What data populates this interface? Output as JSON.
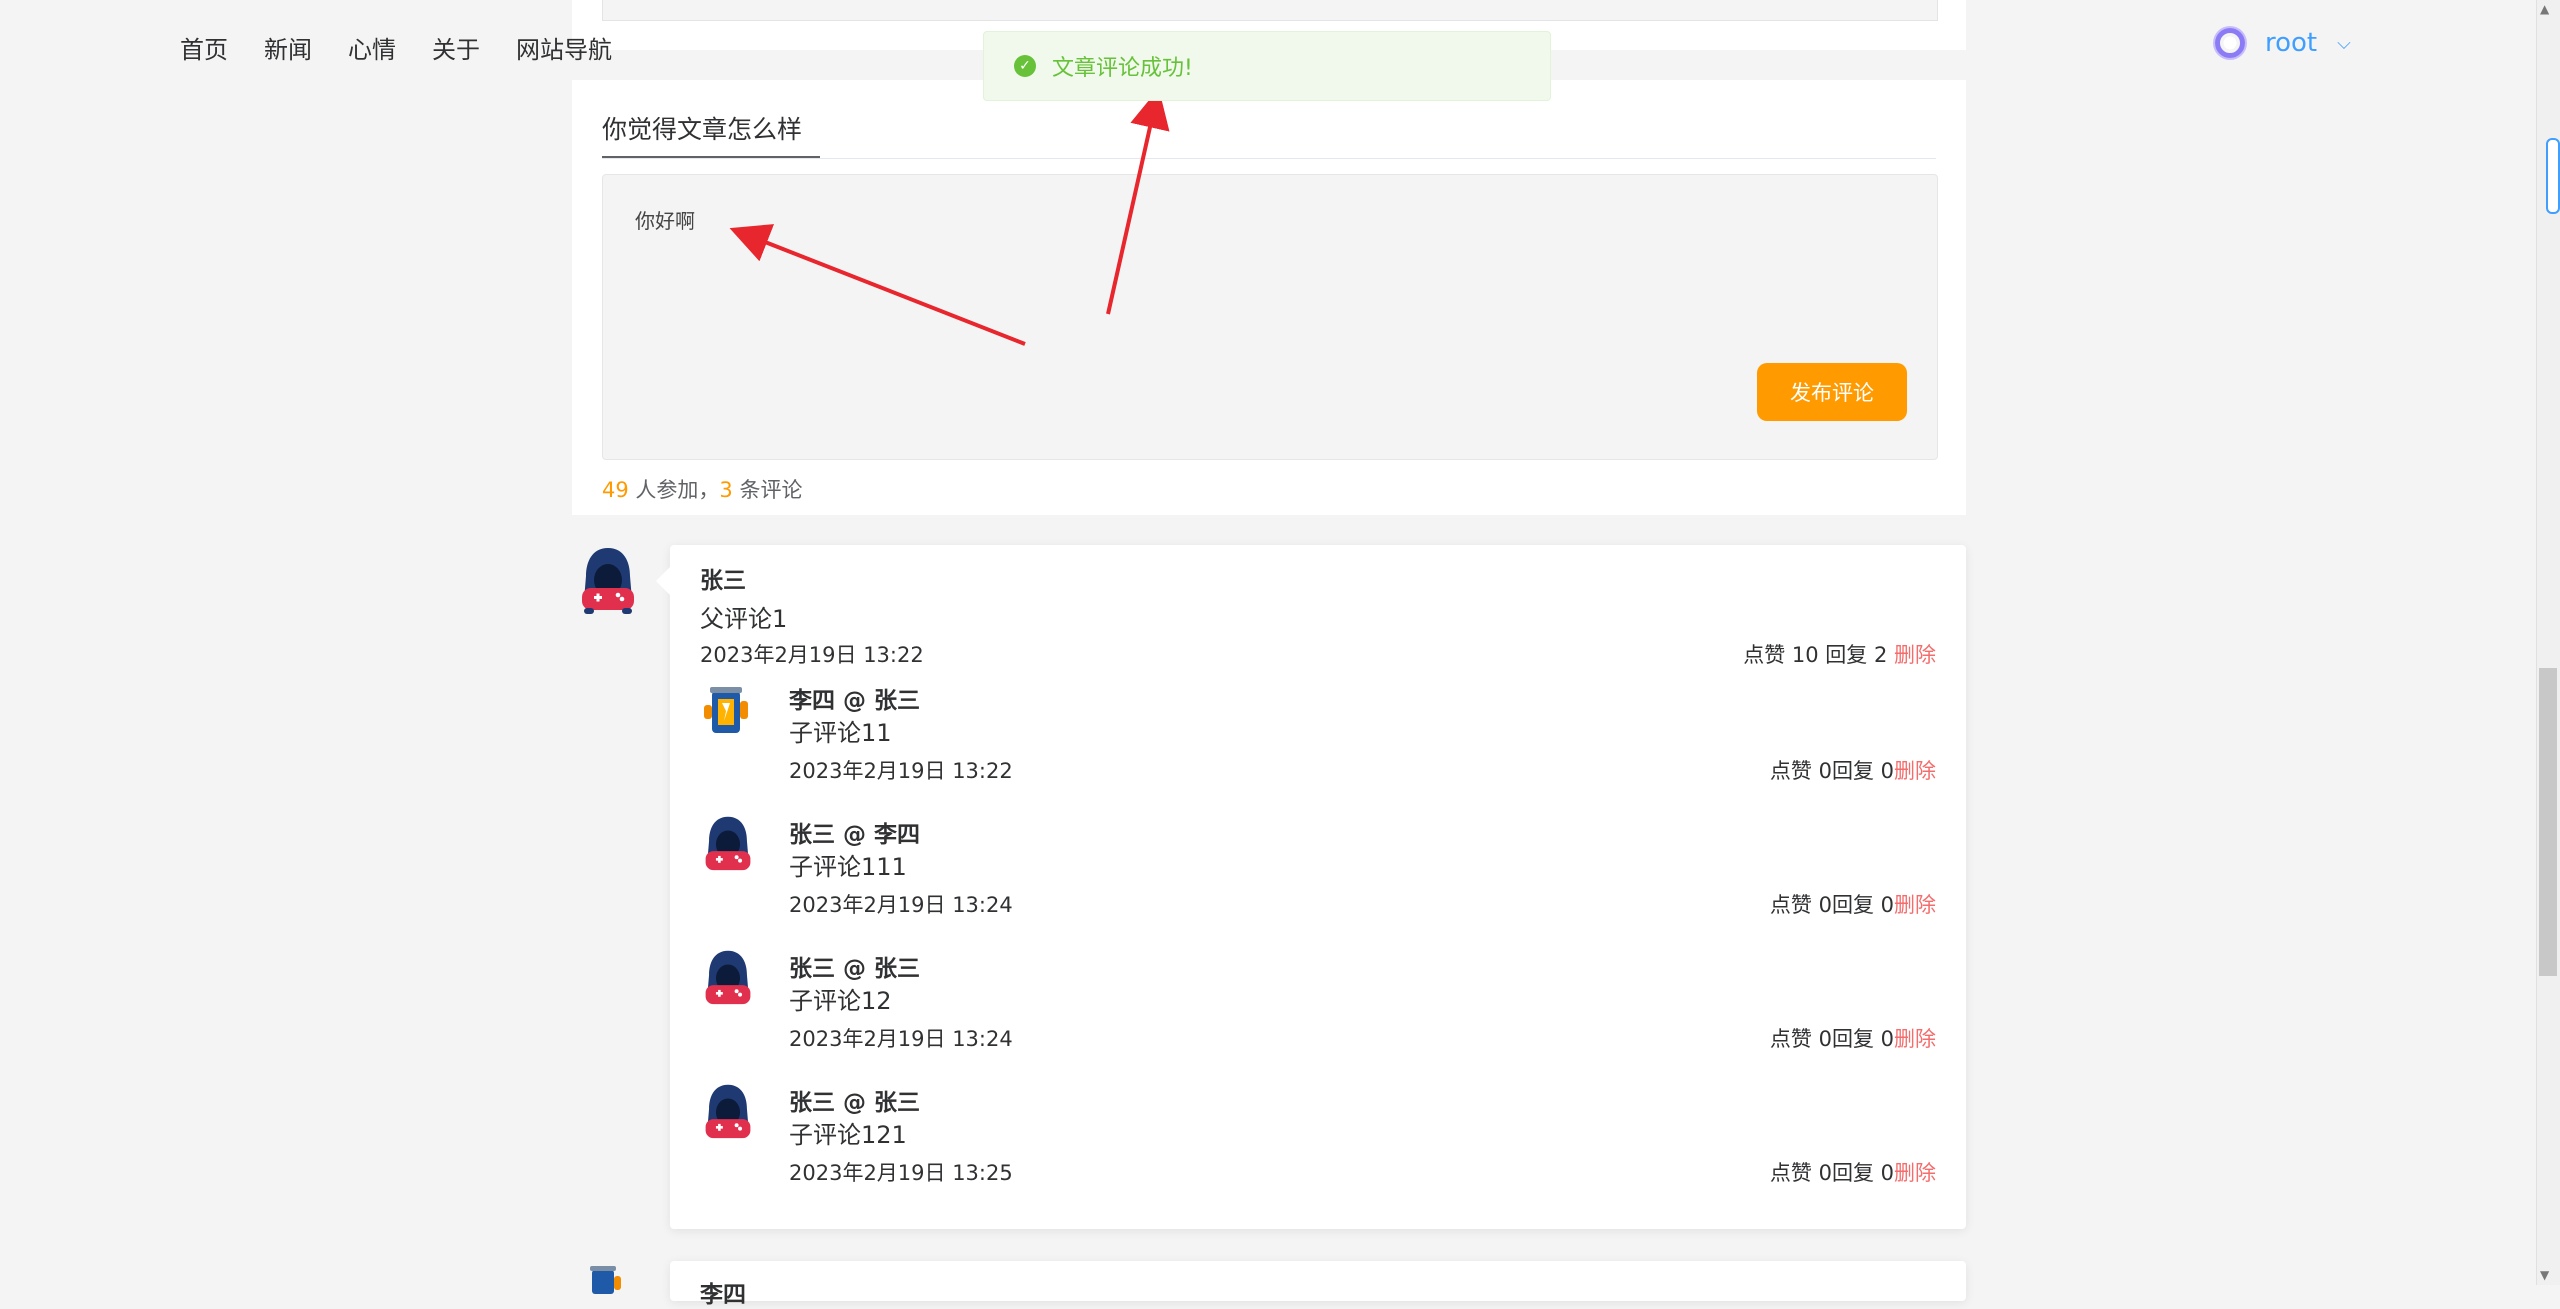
{
  "nav": {
    "items": [
      "首页",
      "新闻",
      "心情",
      "关于",
      "网站导航"
    ]
  },
  "user": {
    "name": "root",
    "chevron": "⌵"
  },
  "toast": {
    "icon": "check-circle-icon",
    "message": "文章评论成功!"
  },
  "editor": {
    "tab_title": "你觉得文章怎么样",
    "content": "你好啊",
    "publish_label": "发布评论"
  },
  "stats": {
    "participants": "49",
    "participants_suffix": " 人参加，",
    "comments": "3",
    "comments_suffix": " 条评论"
  },
  "parent_comment": {
    "name": "张三",
    "text": "父评论1",
    "date": "2023年2月19日 13:22",
    "actions": "点赞 10 回复 2 ",
    "delete_label": "删除"
  },
  "children": [
    {
      "name": "李四 @ 张三",
      "text": "子评论11",
      "date": "2023年2月19日 13:22",
      "actions": "点赞 0回复 0",
      "delete_label": "删除",
      "avatar": "trash-robot-avatar"
    },
    {
      "name": "张三 @ 李四",
      "text": "子评论111",
      "date": "2023年2月19日 13:24",
      "actions": "点赞 0回复 0",
      "delete_label": "删除",
      "avatar": "hooded-gamer-avatar"
    },
    {
      "name": "张三 @ 张三",
      "text": "子评论12",
      "date": "2023年2月19日 13:24",
      "actions": "点赞 0回复 0",
      "delete_label": "删除",
      "avatar": "hooded-gamer-avatar"
    },
    {
      "name": "张三 @ 张三",
      "text": "子评论121",
      "date": "2023年2月19日 13:25",
      "actions": "点赞 0回复 0",
      "delete_label": "删除",
      "avatar": "hooded-gamer-avatar"
    }
  ],
  "next_comment": {
    "name": "李四"
  },
  "colors": {
    "accent_orange": "#ff9a00",
    "link_blue": "#409eff",
    "success_green": "#67c23a",
    "danger_red": "#f56c6c",
    "annotation_red": "#e8262d"
  }
}
